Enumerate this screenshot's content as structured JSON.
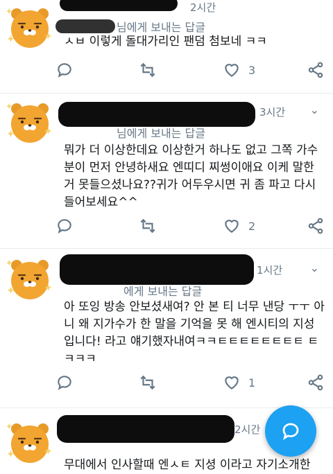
{
  "tweets": [
    {
      "time": "2시간",
      "reply_to": "님에게 보내는 답글",
      "text": "ㅅㅂ 이렇게 돌대가리인 팬덤 첨보네 ㅋㅋ",
      "like_count": "3"
    },
    {
      "time": "3시간",
      "reply_to": "님에게 보내는 답글",
      "text": "뭐가 더 이상한데요 이상한거 하나도 없고 그쪽 가수분이 먼저 안녕하새요 엔띠디 찌썽이애요 이케 말한거 못들으셨나요??귀가 어두우시면 귀 좀 파고 다시 들어보세요^^",
      "like_count": "2"
    },
    {
      "time": "1시간",
      "reply_to": "에게 보내는 답글",
      "text": "아 또잉 방송 안보셨새여? 안 본 티 너무 낸당 ㅜㅜ 아니 왜 지가수가 한 말을 기억을 못 해 엔시티의 지성입니다! 라고 얘기했자내여ㅋㅋㅌㅌㅌㅌㅌㅌㅌㅌ ㅌㅋㅋㅋ",
      "like_count": "1"
    },
    {
      "time": "2시간",
      "text": "무대에서 인사할때 엔ㅅㅌ 지셩 이라고 자기소개한"
    }
  ],
  "icons": {
    "reply": "comment-bubble-icon",
    "retweet": "retweet-icon",
    "like": "heart-icon",
    "share": "share-icon",
    "more": "chevron-down-icon",
    "compose": "compose-reply-icon"
  },
  "colors": {
    "accent": "#1da1f2",
    "muted": "#657786",
    "avatar": "#f2a531"
  }
}
